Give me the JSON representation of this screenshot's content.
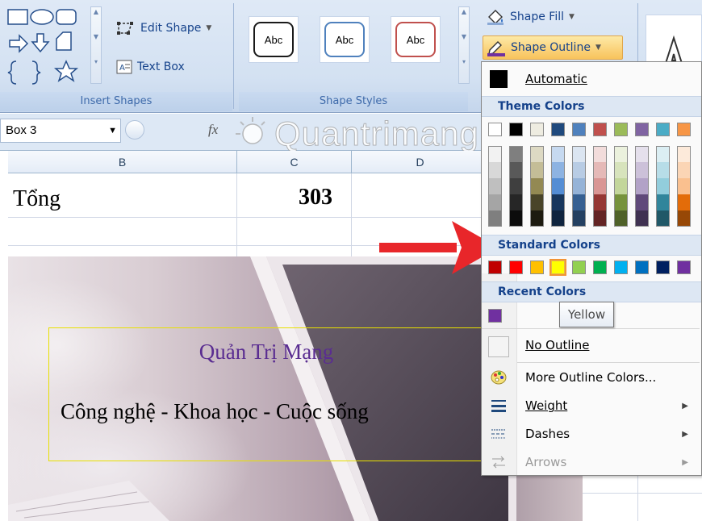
{
  "ribbon": {
    "insert_shapes": {
      "label": "Insert Shapes",
      "edit_shape_label": "Edit Shape",
      "text_box_label": "Text Box"
    },
    "shape_styles": {
      "label": "Shape Styles",
      "sample_text": "Abc",
      "styles": [
        {
          "border": "#1a1a1a"
        },
        {
          "border": "#4f81bd"
        },
        {
          "border": "#c0504d"
        }
      ],
      "shape_fill_label": "Shape Fill",
      "shape_outline_label": "Shape Outline"
    }
  },
  "formula_bar": {
    "name_box": "Box 3",
    "fx": "fx"
  },
  "watermark": "Quantrimang",
  "sheet": {
    "columns": [
      "B",
      "C",
      "D"
    ],
    "rows": [
      {
        "b": "Tổng",
        "c": "303"
      }
    ]
  },
  "textbox": {
    "title": "Quản Trị Mạng",
    "subtitle": "Công nghệ - Khoa học - Cuộc sống"
  },
  "menu": {
    "automatic_label": "Automatic",
    "theme_colors_header": "Theme Colors",
    "standard_colors_header": "Standard Colors",
    "recent_colors_header": "Recent Colors",
    "theme_top_row": [
      "#ffffff",
      "#000000",
      "#eeece1",
      "#1f497d",
      "#4f81bd",
      "#c0504d",
      "#9bbb59",
      "#8064a2",
      "#4bacc6",
      "#f79646"
    ],
    "theme_columns": [
      [
        "#f2f2f2",
        "#d8d8d8",
        "#bfbfbf",
        "#a5a5a5",
        "#7f7f7f"
      ],
      [
        "#7f7f7f",
        "#595959",
        "#3f3f3f",
        "#262626",
        "#0c0c0c"
      ],
      [
        "#ddd9c3",
        "#c4bd97",
        "#938953",
        "#494429",
        "#1d1b10"
      ],
      [
        "#c6d9f0",
        "#8db3e2",
        "#548dd4",
        "#17365d",
        "#0f243e"
      ],
      [
        "#dbe5f1",
        "#b8cce4",
        "#95b3d7",
        "#366092",
        "#244061"
      ],
      [
        "#f2dcdb",
        "#e5b9b7",
        "#d99694",
        "#953734",
        "#632423"
      ],
      [
        "#ebf1dd",
        "#d7e3bc",
        "#c3d69b",
        "#76923c",
        "#4f6128"
      ],
      [
        "#e5e0ec",
        "#ccc1d9",
        "#b2a2c7",
        "#5f497a",
        "#3f3151"
      ],
      [
        "#dbeef3",
        "#b7dde8",
        "#92cddc",
        "#31859b",
        "#205867"
      ],
      [
        "#fdeada",
        "#fbd5b5",
        "#fac08f",
        "#e36c09",
        "#974806"
      ]
    ],
    "standard_colors": [
      "#c00000",
      "#ff0000",
      "#ffc000",
      "#ffff00",
      "#92d050",
      "#00b050",
      "#00b0f0",
      "#0070c0",
      "#002060",
      "#7030a0"
    ],
    "recent_colors": [
      "#7030a0"
    ],
    "tooltip": "Yellow",
    "no_outline_label": "No Outline",
    "more_colors_label": "More Outline Colors...",
    "weight_label": "Weight",
    "dashes_label": "Dashes",
    "arrows_label": "Arrows"
  },
  "colors": {
    "highlight_arrow": "#e8262a",
    "textbox_border": "#e8e000",
    "title_color": "#5a2d91"
  }
}
